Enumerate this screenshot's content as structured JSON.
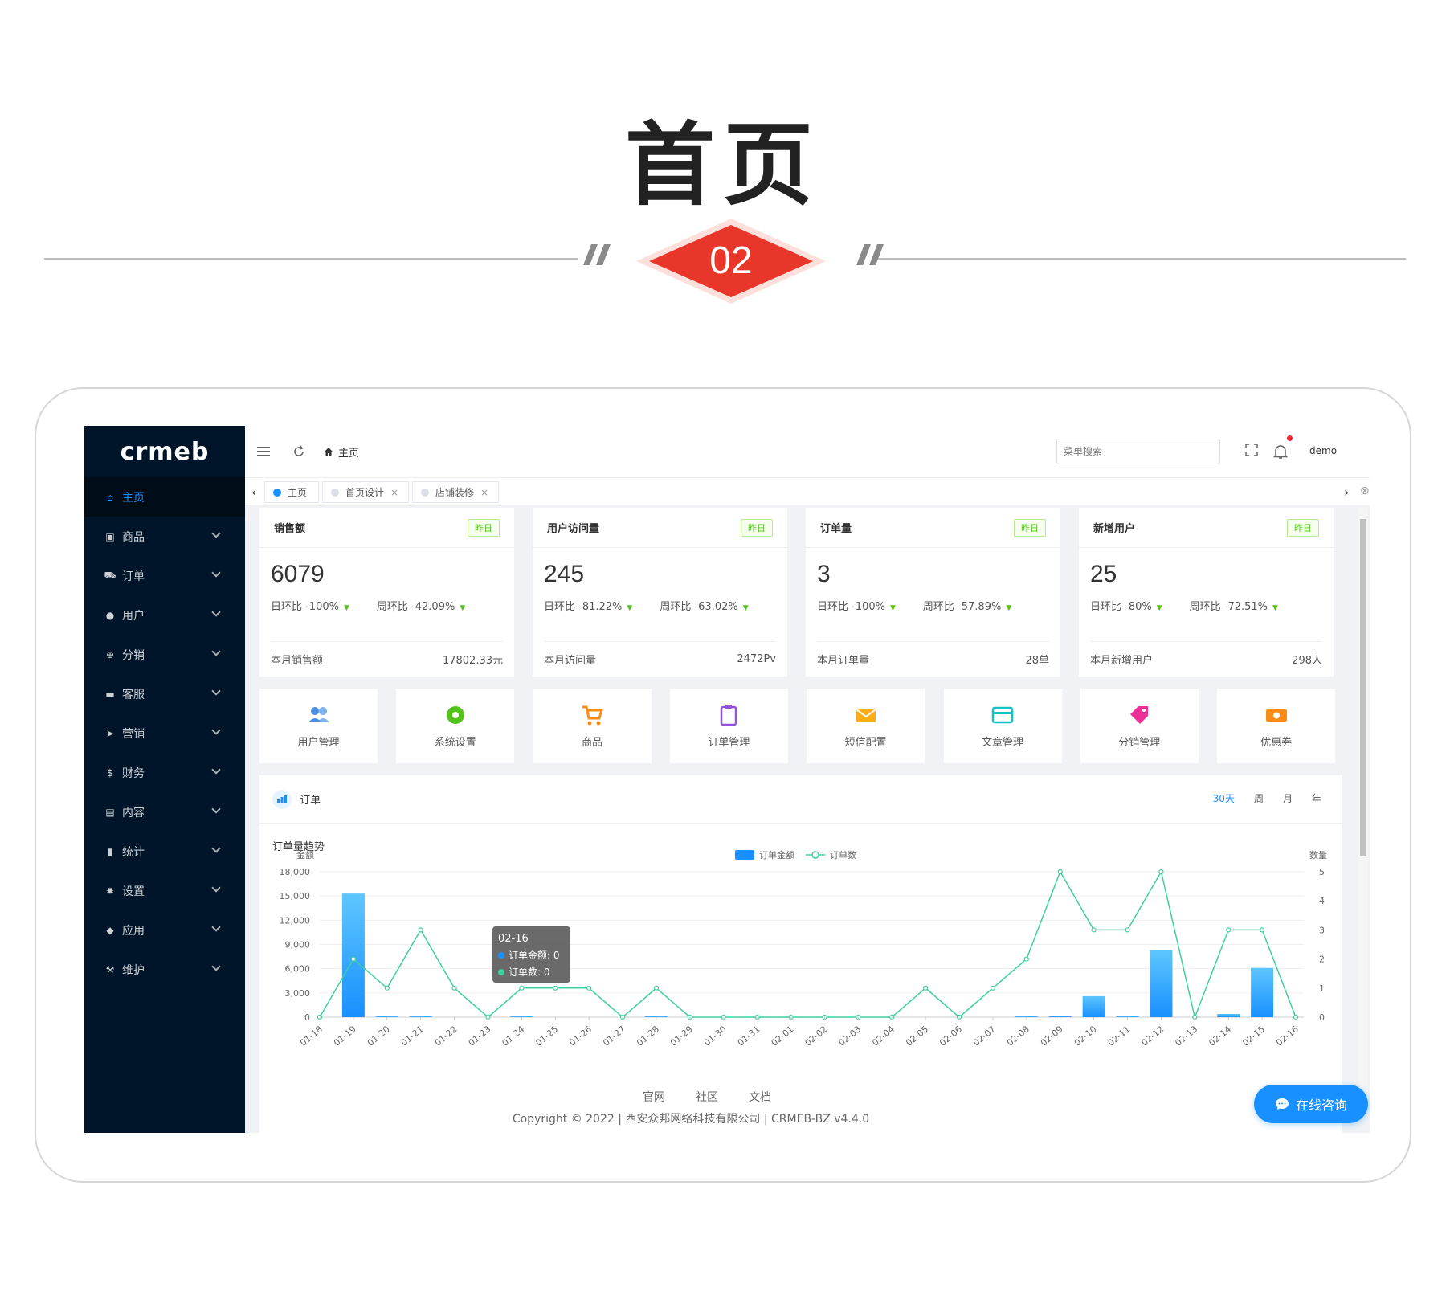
{
  "hero": {
    "title": "首页",
    "number": "02"
  },
  "sidebar": {
    "logo": "crmeb",
    "items": [
      {
        "label": "主页",
        "icon": "home-icon",
        "active": true
      },
      {
        "label": "商品",
        "icon": "shop-icon"
      },
      {
        "label": "订单",
        "icon": "cart-icon"
      },
      {
        "label": "用户",
        "icon": "user-icon"
      },
      {
        "label": "分销",
        "icon": "share-icon"
      },
      {
        "label": "客服",
        "icon": "chat-icon"
      },
      {
        "label": "营销",
        "icon": "send-icon"
      },
      {
        "label": "财务",
        "icon": "dollar-icon"
      },
      {
        "label": "内容",
        "icon": "book-icon"
      },
      {
        "label": "统计",
        "icon": "bar-chart-icon"
      },
      {
        "label": "设置",
        "icon": "gear-icon"
      },
      {
        "label": "应用",
        "icon": "cube-icon"
      },
      {
        "label": "维护",
        "icon": "hammer-icon"
      }
    ]
  },
  "header": {
    "breadcrumb": "主页",
    "search_placeholder": "菜单搜索",
    "user": "demo"
  },
  "tabs": [
    {
      "label": "主页",
      "active": true
    },
    {
      "label": "首页设计"
    },
    {
      "label": "店铺装修"
    }
  ],
  "stats": [
    {
      "title": "销售额",
      "tag": "昨日",
      "value": "6079",
      "day": "日环比 -100%",
      "week": "周环比 -42.09%",
      "foot_label": "本月销售额",
      "foot_value": "17802.33元"
    },
    {
      "title": "用户访问量",
      "tag": "昨日",
      "value": "245",
      "day": "日环比 -81.22%",
      "week": "周环比 -63.02%",
      "foot_label": "本月访问量",
      "foot_value": "2472Pv"
    },
    {
      "title": "订单量",
      "tag": "昨日",
      "value": "3",
      "day": "日环比 -100%",
      "week": "周环比 -57.89%",
      "foot_label": "本月订单量",
      "foot_value": "28单"
    },
    {
      "title": "新增用户",
      "tag": "昨日",
      "value": "25",
      "day": "日环比 -80%",
      "week": "周环比 -72.51%",
      "foot_label": "本月新增用户",
      "foot_value": "298人"
    }
  ],
  "quick_links": [
    {
      "label": "用户管理",
      "icon": "users-icon",
      "color": "#4a90e2"
    },
    {
      "label": "系统设置",
      "icon": "gear-icon",
      "color": "#52c41a"
    },
    {
      "label": "商品",
      "icon": "cart-icon",
      "color": "#fa8c16"
    },
    {
      "label": "订单管理",
      "icon": "clipboard-icon",
      "color": "#9254de"
    },
    {
      "label": "短信配置",
      "icon": "mail-icon",
      "color": "#faad14"
    },
    {
      "label": "文章管理",
      "icon": "card-icon",
      "color": "#13c2c2"
    },
    {
      "label": "分销管理",
      "icon": "tag-icon",
      "color": "#eb2f96"
    },
    {
      "label": "优惠券",
      "icon": "ticket-icon",
      "color": "#fa8c16"
    }
  ],
  "order_panel": {
    "title": "订单",
    "ranges": [
      "30天",
      "周",
      "月",
      "年"
    ],
    "active_range": "30天",
    "chart_title": "订单量趋势"
  },
  "chart_data": {
    "type": "bar",
    "categories": [
      "01-18",
      "01-19",
      "01-20",
      "01-21",
      "01-22",
      "01-23",
      "01-24",
      "01-25",
      "01-26",
      "01-27",
      "01-28",
      "01-29",
      "01-30",
      "01-31",
      "02-01",
      "02-02",
      "02-03",
      "02-04",
      "02-05",
      "02-06",
      "02-07",
      "02-08",
      "02-09",
      "02-10",
      "02-11",
      "02-12",
      "02-13",
      "02-14",
      "02-15",
      "02-16"
    ],
    "series": [
      {
        "name": "订单金额",
        "type": "bar",
        "axis": "left",
        "color": "#1890ff",
        "values": [
          0,
          15300,
          100,
          100,
          0,
          0,
          100,
          0,
          0,
          0,
          100,
          0,
          0,
          0,
          0,
          0,
          0,
          0,
          0,
          0,
          0,
          100,
          200,
          2600,
          100,
          8300,
          0,
          400,
          6100,
          0
        ]
      },
      {
        "name": "订单数",
        "type": "line",
        "axis": "right",
        "color": "#3fd0a0",
        "values": [
          0,
          2,
          1,
          3,
          1,
          0,
          1,
          1,
          1,
          0,
          1,
          0,
          0,
          0,
          0,
          0,
          0,
          0,
          1,
          0,
          1,
          2,
          5,
          3,
          3,
          5,
          0,
          3,
          3,
          0
        ]
      }
    ],
    "ylabel_left": "金额",
    "ylabel_right": "数量",
    "ylim_left": [
      0,
      18000
    ],
    "ylim_right": [
      0,
      5
    ],
    "yticks_left": [
      "0",
      "3,000",
      "6,000",
      "9,000",
      "12,000",
      "15,000",
      "18,000"
    ],
    "yticks_right": [
      "0",
      "1",
      "2",
      "3",
      "4",
      "5"
    ],
    "grid": true,
    "legend": "top-center",
    "tooltip": {
      "title": "02-16",
      "rows": [
        "订单金额: 0",
        "订单数: 0"
      ]
    }
  },
  "footer": {
    "links": [
      "官网",
      "社区",
      "文档"
    ],
    "copyright": "Copyright © 2022 | 西安众邦网络科技有限公司 | CRMEB-BZ v4.4.0"
  },
  "consult_button": "在线咨询",
  "colors": {
    "sidebar_bg": "#001529",
    "accent": "#1890ff",
    "badge_red": "#e8362a"
  }
}
